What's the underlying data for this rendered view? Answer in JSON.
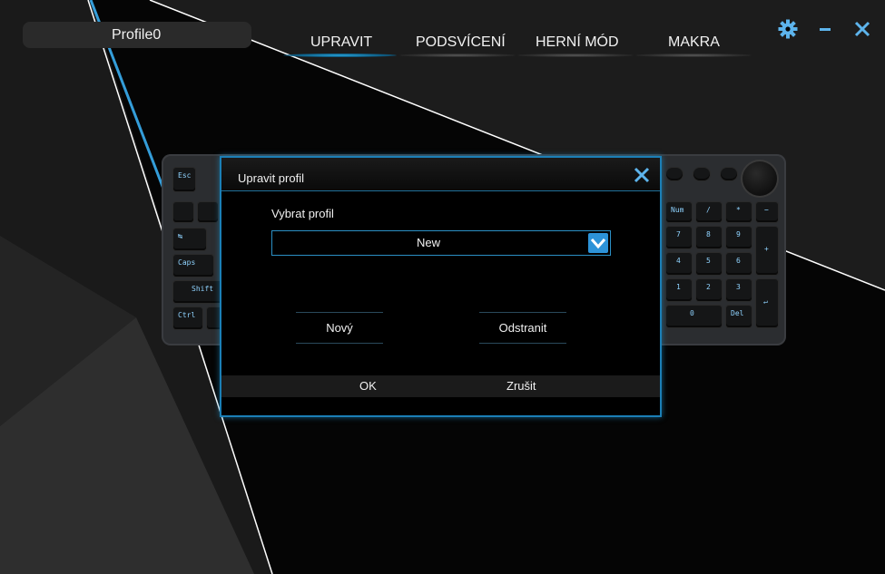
{
  "header": {
    "profile_name": "Profile0"
  },
  "nav": {
    "tabs": [
      {
        "label": "UPRAVIT",
        "active": true
      },
      {
        "label": "PODSVÍCENÍ",
        "active": false
      },
      {
        "label": "HERNÍ MÓD",
        "active": false
      },
      {
        "label": "MAKRA",
        "active": false
      }
    ]
  },
  "window_controls": {
    "settings_icon": "gear-icon",
    "minimize_icon": "minimize-icon",
    "close_icon": "close-icon"
  },
  "keyboard_keys": {
    "esc": "Esc",
    "tab": "↹",
    "caps": "Caps",
    "shift": "Shift",
    "ctrl": "Ctrl",
    "num_slash": "/",
    "num_star": "*",
    "num_minus": "−",
    "num_plus": "+",
    "num_enter": "↵",
    "num_7": "7",
    "num_8": "8",
    "num_9": "9",
    "num_4": "4",
    "num_5": "5",
    "num_6": "6",
    "num_1": "1",
    "num_2": "2",
    "num_3": "3",
    "num_0": "0",
    "num_del": "Del",
    "num_lock": "Num"
  },
  "dialog": {
    "title": "Upravit profil",
    "select_label": "Vybrat profil",
    "select_value": "New",
    "new_button": "Nový",
    "delete_button": "Odstranit",
    "ok_button": "OK",
    "cancel_button": "Zrušit"
  },
  "colors": {
    "accent": "#2d93d8",
    "border": "#1b7fb6",
    "background": "#050505"
  }
}
